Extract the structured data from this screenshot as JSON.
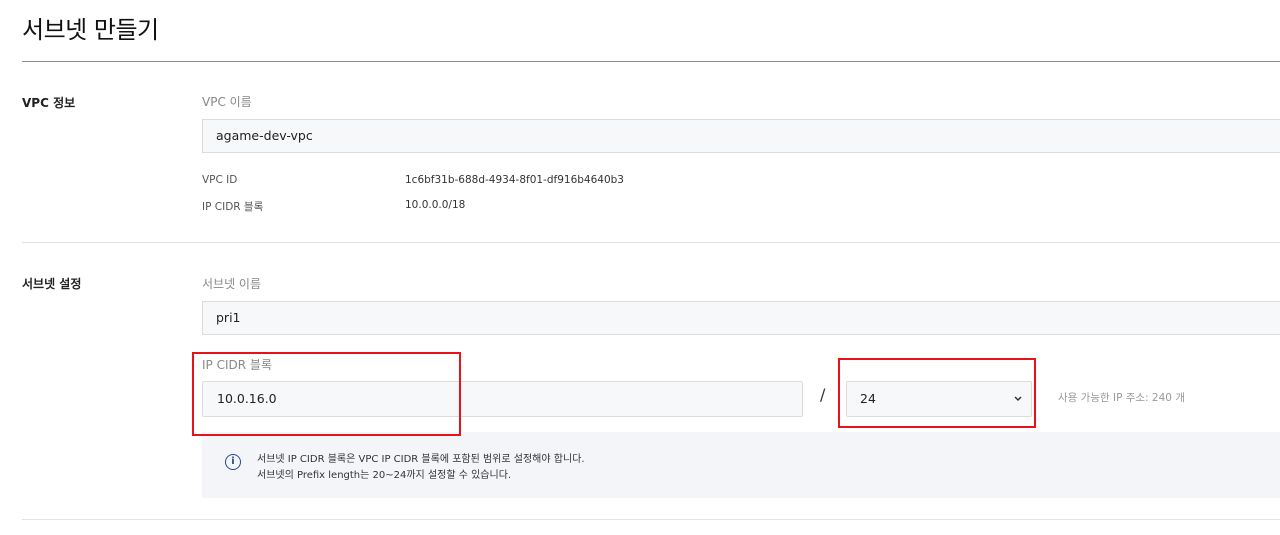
{
  "page": {
    "title": "서브넷 만들기"
  },
  "vpc_info": {
    "section_label": "VPC 정보",
    "name_label": "VPC 이름",
    "name_value": "agame-dev-vpc",
    "id_key": "VPC ID",
    "id_value": "1c6bf31b-688d-4934-8f01-df916b4640b3",
    "cidr_key": "IP CIDR 블록",
    "cidr_value": "10.0.0.0/18"
  },
  "subnet": {
    "section_label": "서브넷 설정",
    "name_label": "서브넷 이름",
    "name_value": "pri1",
    "cidr_label": "IP CIDR 블록",
    "cidr_value": "10.0.16.0",
    "slash": "/",
    "prefix_value": "24",
    "available_ip": "사용 가능한 IP 주소: 240 개",
    "info_line1": "서브넷 IP CIDR 블록은 VPC IP CIDR 블록에 포함된 범위로 설정해야 합니다.",
    "info_line2": "서브넷의 Prefix length는 20~24까지 설정할 수 있습니다."
  },
  "icons": {
    "info": "info-icon",
    "chevron": "chevron-down-icon"
  },
  "colors": {
    "highlight": "#e8131a",
    "info_icon": "#2a4a88"
  }
}
